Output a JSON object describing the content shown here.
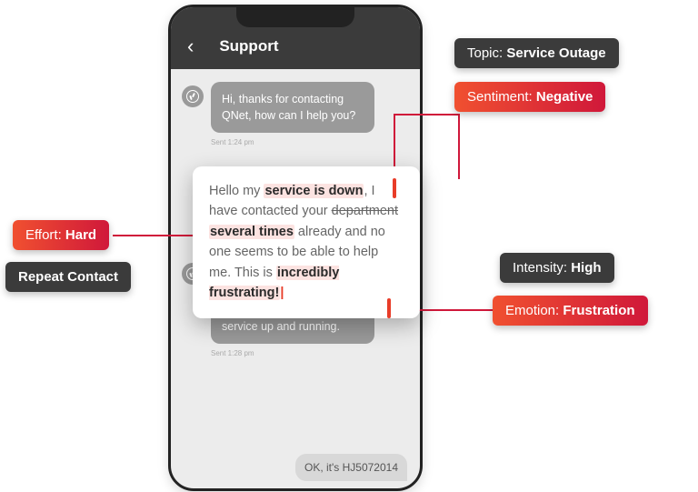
{
  "header": {
    "title": "Support",
    "back_icon": "‹"
  },
  "messages": {
    "m1": {
      "text": "Hi, thanks for contacting QNet, how can I help you?",
      "meta": "Sent 1:24 pm"
    },
    "m2": {
      "prefix": "Hello my ",
      "span1": "service is down",
      "mid1": ", I have contacted your ",
      "strike": "department",
      "span2": "several times",
      "mid2": " already and no one seems to be able to help me. This is ",
      "span3": "incredibly frustrating!"
    },
    "m3": {
      "text": "Oh I'm sorry! Let me get your account number so I can help you get your service up and running.",
      "meta": "Sent 1:28 pm"
    },
    "m4": {
      "text": "OK, it's HJ5072014"
    }
  },
  "tags": {
    "topic": {
      "k": "Topic: ",
      "v": "Service Outage"
    },
    "sentiment": {
      "k": "Sentiment: ",
      "v": "Negative"
    },
    "effort": {
      "k": "Effort: ",
      "v": "Hard"
    },
    "repeat": {
      "v": "Repeat Contact"
    },
    "intensity": {
      "k": "Intensity: ",
      "v": "High"
    },
    "emotion": {
      "k": "Emotion: ",
      "v": "Frustration"
    }
  }
}
